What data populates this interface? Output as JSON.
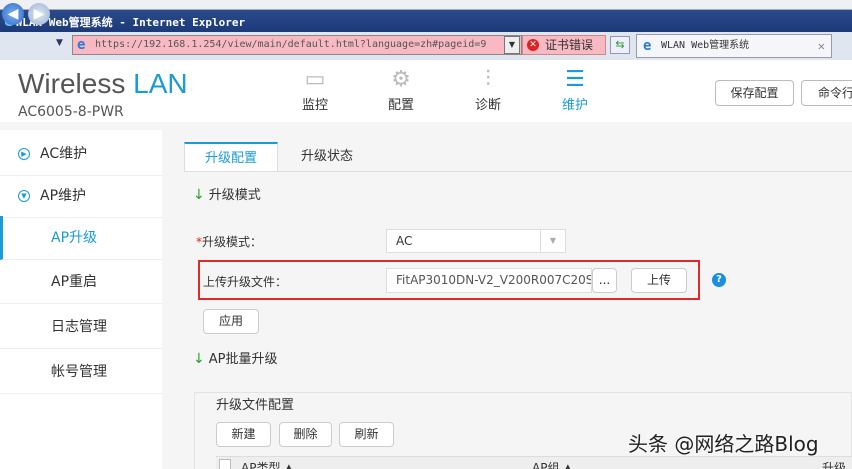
{
  "browser": {
    "title": "WLAN Web管理系统 - Internet Explorer",
    "url": "https://192.168.1.254/view/main/default.html?language=zh#pageid=9",
    "cert_error": "证书错误",
    "tab_title": "WLAN Web管理系统"
  },
  "header": {
    "logo_main": "Wireless",
    "logo_accent": "LAN",
    "model": "AC6005-8-PWR",
    "nav": [
      {
        "label": "监控",
        "icon": "monitor-icon"
      },
      {
        "label": "配置",
        "icon": "gear-icon"
      },
      {
        "label": "诊断",
        "icon": "sliders-icon"
      },
      {
        "label": "维护",
        "icon": "maintenance-icon"
      }
    ],
    "save_label": "保存配置",
    "cli_label": "命令行"
  },
  "sidebar": {
    "items": [
      {
        "label": "AC维护"
      },
      {
        "label": "AP维护"
      },
      {
        "label": "AP升级"
      },
      {
        "label": "AP重启"
      },
      {
        "label": "日志管理"
      },
      {
        "label": "帐号管理"
      }
    ]
  },
  "tabs": {
    "config": "升级配置",
    "status": "升级状态"
  },
  "section1": {
    "title": "升级模式",
    "mode_label": "升级模式：",
    "mode_value": "AC",
    "upload_label": "上传升级文件：",
    "file_value": "FitAP3010DN-V2_V200R007C20S",
    "browse": "...",
    "upload": "上传",
    "help": "?",
    "apply": "应用"
  },
  "section2": {
    "title": "AP批量升级",
    "panel_title": "升级文件配置",
    "new": "新建",
    "delete": "删除",
    "refresh": "刷新",
    "columns": [
      "AP类型 ▲",
      "AP组 ▲",
      "升级"
    ]
  },
  "watermark": "头条 @网络之路Blog",
  "colors": {
    "accent": "#1a9bd7",
    "highlight": "#e12b2b"
  }
}
